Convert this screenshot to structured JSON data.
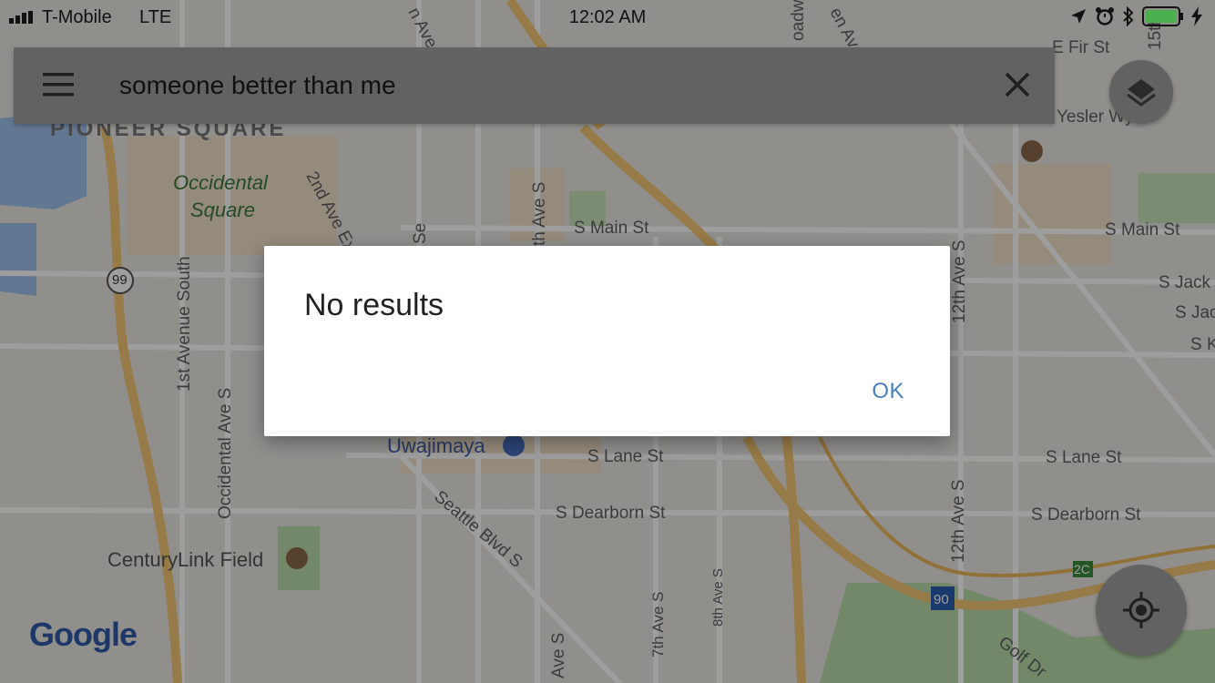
{
  "status_bar": {
    "carrier": "T-Mobile",
    "network": "LTE",
    "time": "12:02 AM",
    "icons": [
      "location-arrow-icon",
      "alarm-icon",
      "bluetooth-icon",
      "battery-icon",
      "charging-bolt-icon"
    ]
  },
  "search": {
    "query": "someone better than me",
    "menu_icon": "hamburger-menu-icon",
    "clear_icon": "close-icon"
  },
  "map": {
    "labels": [
      "PIONEER SQUARE",
      "Occidental",
      "Square",
      "2nd Ave Ex",
      "S Main St",
      "S Main St",
      "Yesler Wy",
      "E Fir St",
      "S Jack",
      "S Jac",
      "S K",
      "12th Ave S",
      "1st Avenue South",
      "Occidental Ave S",
      "Uwajimaya",
      "S Lane St",
      "S Lane St",
      "S Dearborn St",
      "S Dearborn St",
      "Seattle Blvd S",
      "CenturyLink Field",
      "7th Ave S",
      "8th Ave S",
      "12th Ave S",
      "Golf Dr",
      "99",
      "90",
      "2C",
      "th Ave S",
      "n Ave",
      "oadw",
      "en Av",
      "15th",
      "Ave S",
      "Se"
    ],
    "attribution": "Google"
  },
  "buttons": {
    "layers_icon": "layers-icon",
    "locate_icon": "my-location-icon"
  },
  "dialog": {
    "title": "No results",
    "ok_label": "OK"
  },
  "colors": {
    "accent": "#4a7fc1",
    "road_major": "#f2c573",
    "park": "#b9dcaa",
    "water": "#9fc0ea"
  }
}
